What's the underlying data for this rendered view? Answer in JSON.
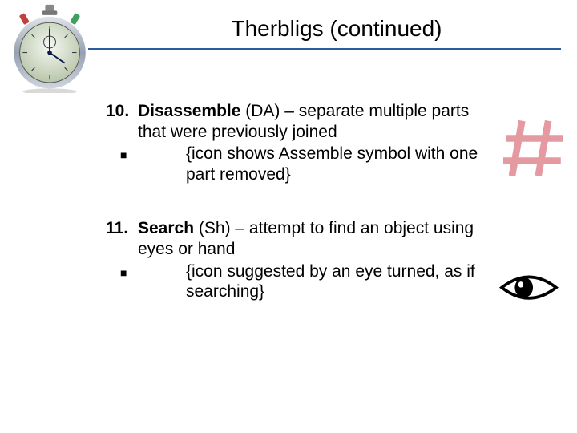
{
  "title": "Therbligs (continued)",
  "icons": {
    "stopwatch": "stopwatch-icon",
    "hash": "disassemble-icon",
    "eye": "search-eye-icon"
  },
  "items": [
    {
      "number": "10.",
      "name": "Disassemble",
      "code": "(DA)",
      "rest": " – separate multiple parts that were previously joined",
      "bullet": "{icon shows Assemble symbol with one part removed}"
    },
    {
      "number": "11.",
      "name": "Search",
      "code": "(Sh)",
      "rest": " – attempt to find an object using eyes or hand",
      "bullet": "{icon suggested by an eye turned, as if searching}"
    }
  ]
}
